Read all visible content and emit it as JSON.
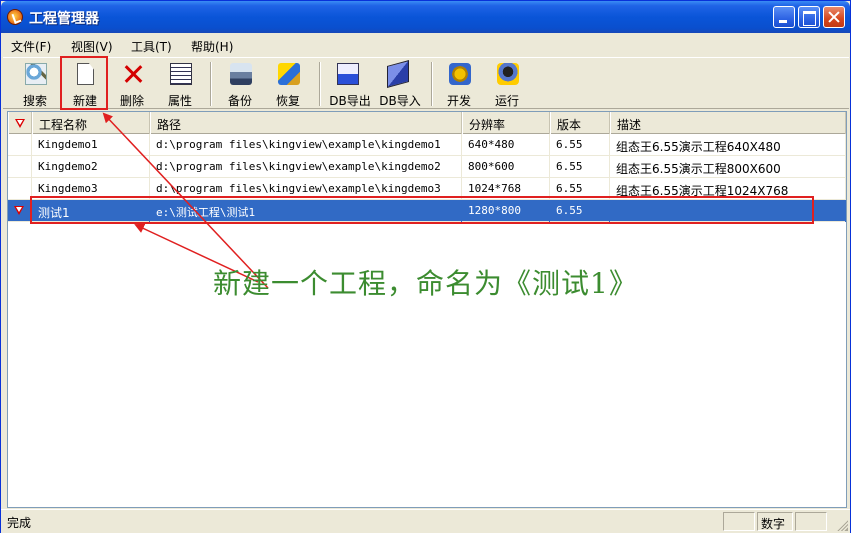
{
  "window": {
    "title": "工程管理器"
  },
  "menu": {
    "file": "文件(F)",
    "view": "视图(V)",
    "tools": "工具(T)",
    "help": "帮助(H)"
  },
  "toolbar": {
    "search": "搜索",
    "new": "新建",
    "delete": "删除",
    "properties": "属性",
    "backup": "备份",
    "restore": "恢复",
    "db_export": "DB导出",
    "db_import": "DB导入",
    "develop": "开发",
    "run": "运行"
  },
  "table": {
    "columns": [
      "工程名称",
      "路径",
      "分辨率",
      "版本",
      "描述"
    ],
    "rows": [
      {
        "name": "Kingdemo1",
        "path": "d:\\program files\\kingview\\example\\kingdemo1",
        "resolution": "640*480",
        "version": "6.55",
        "description": "组态王6.55演示工程640X480"
      },
      {
        "name": "Kingdemo2",
        "path": "d:\\program files\\kingview\\example\\kingdemo2",
        "resolution": "800*600",
        "version": "6.55",
        "description": "组态王6.55演示工程800X600"
      },
      {
        "name": "Kingdemo3",
        "path": "d:\\program files\\kingview\\example\\kingdemo3",
        "resolution": "1024*768",
        "version": "6.55",
        "description": "组态王6.55演示工程1024X768"
      },
      {
        "name": "测试1",
        "path": "e:\\测试工程\\测试1",
        "resolution": "1280*800",
        "version": "6.55",
        "description": ""
      }
    ],
    "selected_row": 3
  },
  "annotation": {
    "text": "新建一个工程，命名为《测试1》",
    "color": "#3c8c30",
    "highlight_color": "#e02020"
  },
  "statusbar": {
    "text": "完成",
    "num_indicator": "数字"
  },
  "colors": {
    "titlebar": "#0a55d8",
    "selection": "#316ac5",
    "face": "#ece9d8"
  }
}
